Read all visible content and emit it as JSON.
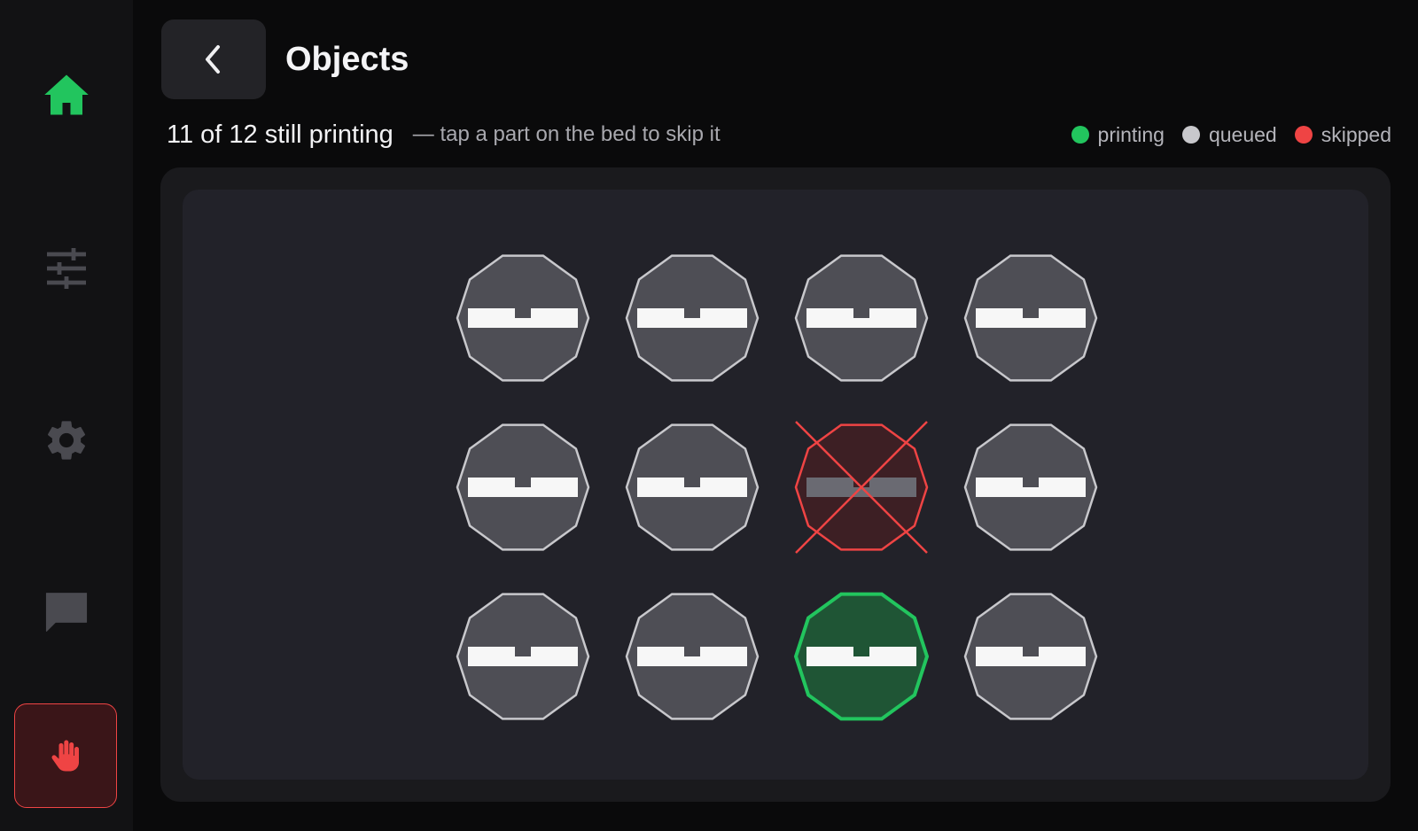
{
  "header": {
    "title": "Objects"
  },
  "status": {
    "progress_text": "11 of 12 still printing",
    "hint": "— tap a part on the bed to skip it"
  },
  "legend": {
    "printing": "printing",
    "queued": "queued",
    "skipped": "skipped"
  },
  "colors": {
    "printing": "#22c55e",
    "queued": "#c8c8cc",
    "skipped": "#ef4444",
    "accent_home": "#22c55e"
  },
  "sidebar": {
    "items": [
      {
        "icon": "home-icon",
        "active": true
      },
      {
        "icon": "sliders-icon",
        "active": false
      },
      {
        "icon": "gear-icon",
        "active": false
      },
      {
        "icon": "chat-icon",
        "active": false
      },
      {
        "icon": "hand-stop-icon",
        "emergency": true
      }
    ]
  },
  "objects": [
    {
      "row": 0,
      "col": 0,
      "state": "queued"
    },
    {
      "row": 0,
      "col": 1,
      "state": "queued"
    },
    {
      "row": 0,
      "col": 2,
      "state": "queued"
    },
    {
      "row": 0,
      "col": 3,
      "state": "queued"
    },
    {
      "row": 1,
      "col": 0,
      "state": "queued"
    },
    {
      "row": 1,
      "col": 1,
      "state": "queued"
    },
    {
      "row": 1,
      "col": 2,
      "state": "skipped"
    },
    {
      "row": 1,
      "col": 3,
      "state": "queued"
    },
    {
      "row": 2,
      "col": 0,
      "state": "queued"
    },
    {
      "row": 2,
      "col": 1,
      "state": "queued"
    },
    {
      "row": 2,
      "col": 2,
      "state": "printing"
    },
    {
      "row": 2,
      "col": 3,
      "state": "queued"
    }
  ]
}
